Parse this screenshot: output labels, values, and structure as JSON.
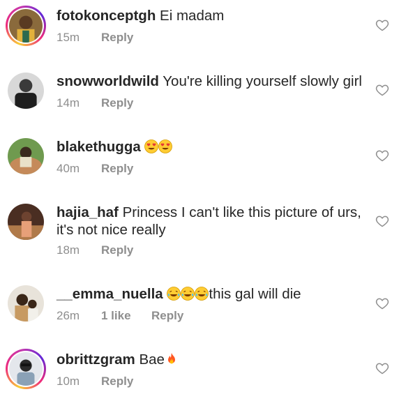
{
  "comments": [
    {
      "username": "fotokonceptgh",
      "text": "Ei madam",
      "time": "15m",
      "reply": "Reply"
    },
    {
      "username": "snowworldwild",
      "text": "You're killing yourself slowly girl",
      "time": "14m",
      "reply": "Reply"
    },
    {
      "username": "blakethugga",
      "text": "",
      "time": "40m",
      "reply": "Reply"
    },
    {
      "username": "hajia_haf",
      "text": "Princess I can't like this picture of urs, it's not nice really",
      "time": "18m",
      "reply": "Reply"
    },
    {
      "username": "__emma_nuella",
      "text": "this gal will die",
      "time": "26m",
      "likes": "1 like",
      "reply": "Reply"
    },
    {
      "username": "obrittzgram",
      "text": "Bae",
      "time": "10m",
      "reply": "Reply"
    }
  ],
  "icons": {
    "heart": "heart-outline-icon",
    "heart_eyes": "heart-eyes-emoji",
    "laughing": "tears-of-joy-emoji",
    "fire": "fire-emoji"
  },
  "colors": {
    "text": "#262626",
    "meta": "#8e8e8e",
    "heart": "#8e8e8e"
  }
}
